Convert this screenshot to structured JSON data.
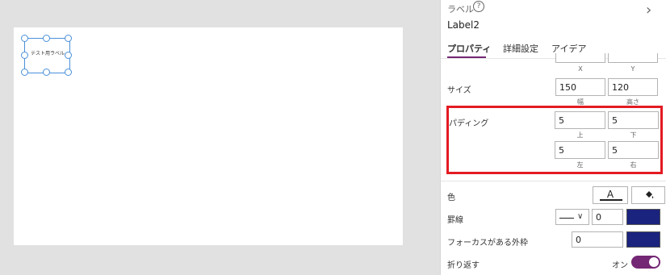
{
  "canvas": {
    "label_text": "テスト用ラベル"
  },
  "panel": {
    "control_type": "ラベル",
    "help_symbol": "?",
    "chevron": "›",
    "control_name": "Label2",
    "tabs": [
      {
        "label": "プロパティ",
        "active": true
      },
      {
        "label": "詳細設定",
        "active": false
      },
      {
        "label": "アイデア",
        "active": false
      }
    ],
    "position": {
      "x_caption": "X",
      "y_caption": "Y"
    },
    "size": {
      "label": "サイズ",
      "width": "150",
      "height": "120",
      "width_caption": "幅",
      "height_caption": "高さ"
    },
    "padding": {
      "label": "パディング",
      "top": "5",
      "bottom": "5",
      "left": "5",
      "right": "5",
      "top_caption": "上",
      "bottom_caption": "下",
      "left_caption": "左",
      "right_caption": "右"
    },
    "color": {
      "label": "色",
      "font_glyph": "A"
    },
    "border": {
      "label": "罫線",
      "width": "0",
      "color": "#1a237e"
    },
    "focus_border": {
      "label": "フォーカスがある外枠",
      "width": "0",
      "color": "#1a237e"
    },
    "wrap": {
      "label": "折り返す",
      "state_text": "オン",
      "on": true
    }
  },
  "colors": {
    "accent": "#742774",
    "highlight": "#e31b23"
  }
}
